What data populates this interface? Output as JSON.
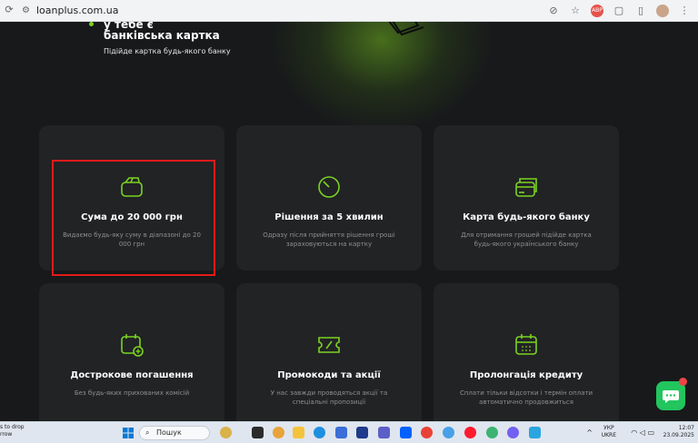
{
  "browser": {
    "url": "loanplus.com.ua"
  },
  "hero": {
    "prev_title": "у тебе є",
    "title": "банківська картка",
    "subtitle": "Підійде картка будь-якого банку"
  },
  "features": [
    {
      "title": "Сума до 20 000 грн",
      "desc": "Видаємо будь-яку суму в діапазоні до 20 000 грн",
      "icon": "wallet-icon"
    },
    {
      "title": "Рішення за 5 хвилин",
      "desc": "Одразу після прийняття рішення гроші зараховуються на картку",
      "icon": "timer-icon"
    },
    {
      "title": "Карта будь-якого банку",
      "desc": "Для отримання грошей підійде картка будь-якого українського банку",
      "icon": "bank-cards-icon"
    },
    {
      "title": "Дострокове погашення",
      "desc": "Без будь-яких прихованих комісій",
      "icon": "calendar-plus-icon"
    },
    {
      "title": "Промокоди та акції",
      "desc": "У нас завжди проводяться акції та спеціальні пропозиції",
      "icon": "ticket-icon"
    },
    {
      "title": "Пролонгація кредиту",
      "desc": "Сплати тільки відсотки і термін оплати автоматично продовжиться",
      "icon": "calendar-icon"
    }
  ],
  "taskbar": {
    "left_line1": "s to drop",
    "left_line2": "rrow",
    "search_placeholder": "Пошук",
    "lang_line1": "УКР",
    "lang_line2": "UKRE",
    "time": "12:07",
    "date": "23.09.2025"
  },
  "colors": {
    "accent": "#7bd321",
    "card_bg": "#222325",
    "page_bg": "#18191b",
    "highlight": "#e21b1b",
    "chat": "#22c55e"
  }
}
